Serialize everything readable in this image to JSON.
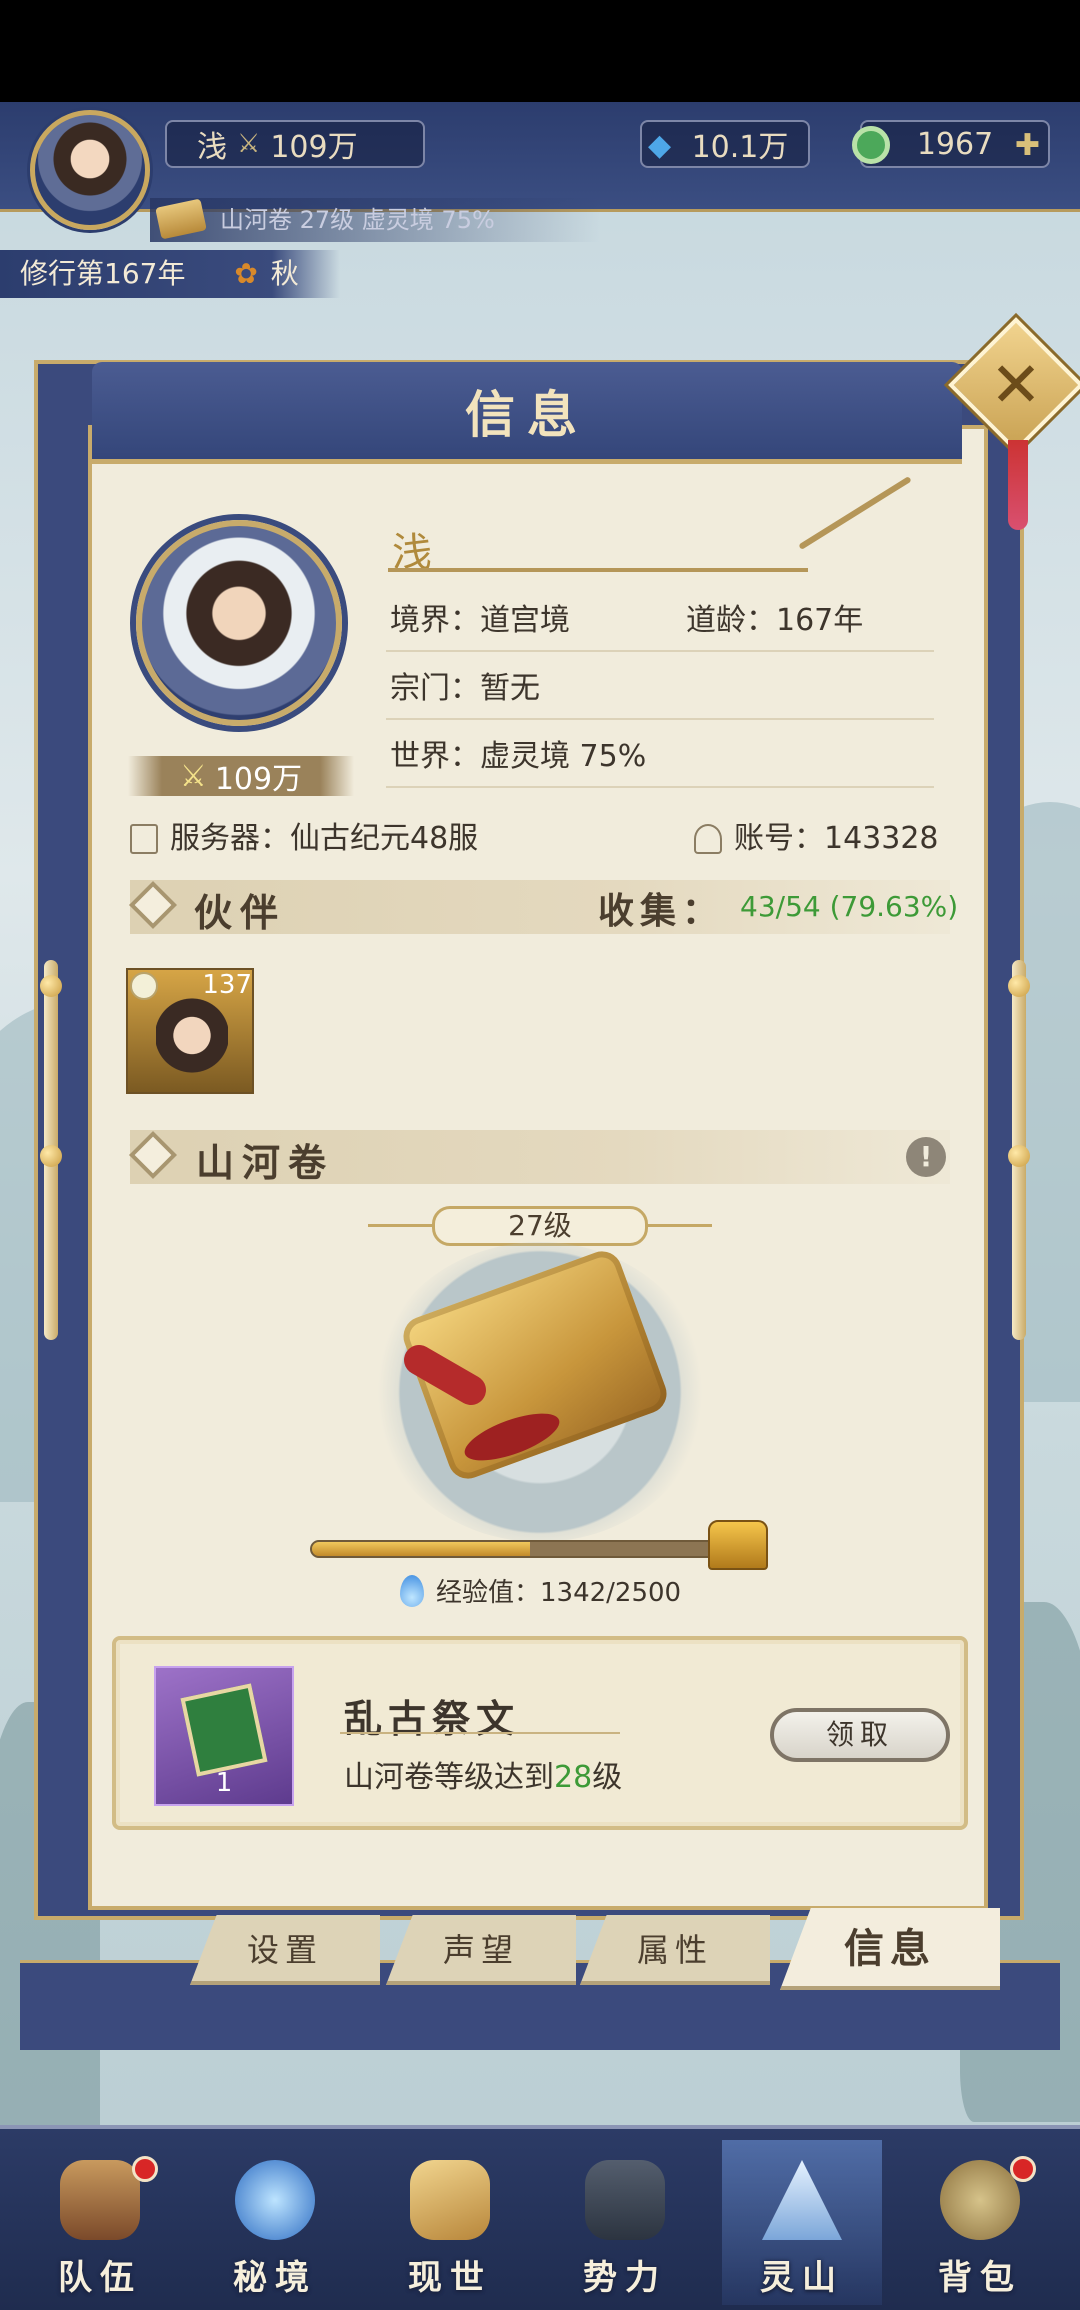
{
  "hud": {
    "player_name": "浅",
    "power": "109万",
    "crystal": "10.1万",
    "jade": "1967",
    "sub_status": "山河卷 27级 虚灵境 75%",
    "year": "修行第167年",
    "season": "秋",
    "colors": {
      "hud_blue": "#2c3d6e",
      "gold": "#c8ab6b"
    }
  },
  "panel": {
    "title": "信息",
    "profile": {
      "name": "浅",
      "power_badge": "109万",
      "realm": "境界：道宫境",
      "age": "道龄：167年",
      "sect": "宗门：暂无",
      "world": "世界：虚灵境  75%",
      "server": "服务器：仙古纪元48服",
      "account": "账号：143328"
    },
    "companions": {
      "title": "伙伴",
      "collect_label": "收集：",
      "collect_value": "43/54 (79.63%)",
      "items": [
        {
          "level": "137"
        }
      ]
    },
    "shanhe": {
      "title": "山河卷",
      "warning_glyph": "!",
      "level": "27级",
      "exp_text": "经验值：1342/2500",
      "exp_fraction": 0.5368
    },
    "reward": {
      "title": "乱古祭文",
      "desc_prefix": "山河卷等级达到",
      "desc_level": "28",
      "desc_suffix": "级",
      "quantity": "1",
      "claim_label": "领取"
    },
    "close_glyph": "✕"
  },
  "tabs": [
    {
      "label": "设置",
      "active": false
    },
    {
      "label": "声望",
      "active": false
    },
    {
      "label": "属性",
      "active": false
    },
    {
      "label": "信息",
      "active": true
    }
  ],
  "bottom_nav": [
    {
      "label": "队伍",
      "icon": "team-icon",
      "badge": true,
      "active": false
    },
    {
      "label": "秘境",
      "icon": "realm-icon",
      "badge": false,
      "active": false
    },
    {
      "label": "现世",
      "icon": "world-icon",
      "badge": false,
      "active": false
    },
    {
      "label": "势力",
      "icon": "faction-icon",
      "badge": false,
      "active": false
    },
    {
      "label": "灵山",
      "icon": "mountain-icon",
      "badge": false,
      "active": true
    },
    {
      "label": "背包",
      "icon": "bag-icon",
      "badge": true,
      "active": false
    }
  ]
}
